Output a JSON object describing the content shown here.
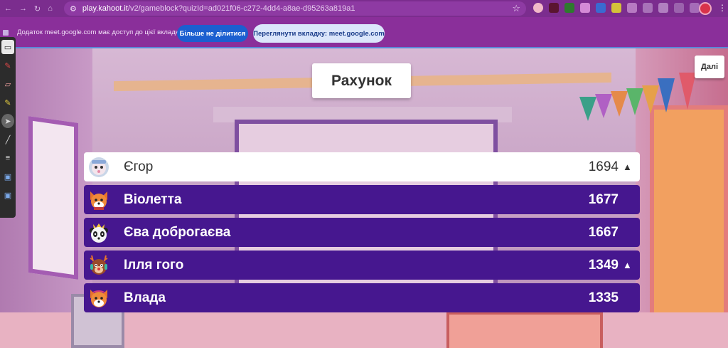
{
  "browser": {
    "url_host": "play.kahoot.it",
    "url_path": "/v2/gameblock?quizId=ad021f06-c272-4dd4-a8ae-d95263a819a1"
  },
  "share_banner": {
    "message": "Додаток meet.google.com має доступ до цієї вкладки",
    "stop_label": "Більше не ділитися",
    "view_label": "Переглянути вкладку: meet.google.com"
  },
  "game": {
    "title": "Рахунок",
    "next_label": "Далі",
    "players": [
      {
        "name": "Єгор",
        "score": "1694",
        "arrow": "▲",
        "avatar": "astronaut-avatar"
      },
      {
        "name": "Віолетта",
        "score": "1677",
        "arrow": "",
        "avatar": "fox-avatar"
      },
      {
        "name": "Єва доброгаєва",
        "score": "1667",
        "arrow": "",
        "avatar": "panda-avatar"
      },
      {
        "name": "Ілля гого",
        "score": "1349",
        "arrow": "▲",
        "avatar": "reindeer-avatar"
      },
      {
        "name": "Влада",
        "score": "1335",
        "arrow": "",
        "avatar": "fox-avatar"
      }
    ]
  },
  "colors": {
    "row_purple": "#46178f",
    "row_highlight": "#ffffff",
    "browser_bar": "#7b2d8e"
  }
}
